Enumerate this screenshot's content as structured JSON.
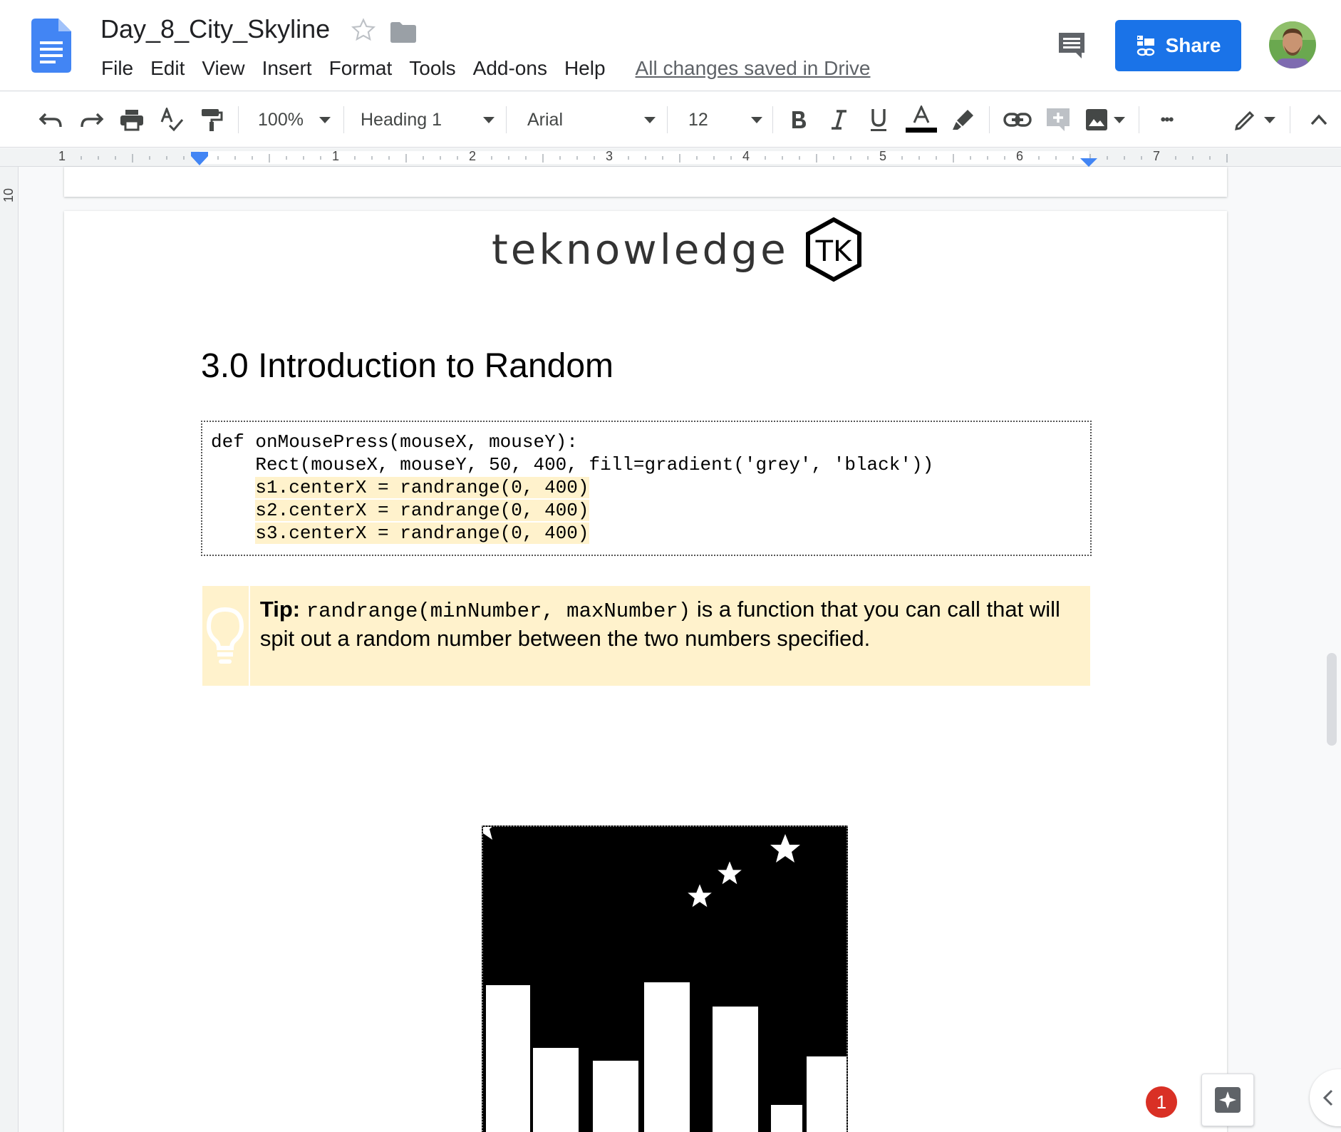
{
  "app": {
    "name": "Google Docs"
  },
  "header": {
    "doc_title": "Day_8_City_Skyline",
    "menu": [
      "File",
      "Edit",
      "View",
      "Insert",
      "Format",
      "Tools",
      "Add-ons",
      "Help"
    ],
    "save_status": "All changes saved in Drive",
    "share_label": "Share"
  },
  "toolbar": {
    "zoom": "100%",
    "style": "Heading 1",
    "font": "Arial",
    "font_size": "12",
    "more_label": "•••",
    "icons": [
      "undo-icon",
      "redo-icon",
      "print-icon",
      "spellcheck-icon",
      "paint-format-icon",
      "bold-icon",
      "italic-icon",
      "underline-icon",
      "text-color-icon",
      "highlight-icon",
      "link-icon",
      "add-comment-icon",
      "image-icon",
      "more-icon",
      "editing-mode-icon",
      "collapse-icon"
    ]
  },
  "ruler": {
    "labels": [
      "1",
      "1",
      "2",
      "3",
      "4",
      "5",
      "6",
      "7"
    ],
    "vertical_label": "10"
  },
  "document": {
    "brand": "teknowledge",
    "brand_mark": "TK",
    "heading": "3.0 Introduction to Random",
    "code": {
      "line1": "def onMousePress(mouseX, mouseY):",
      "line2": "    Rect(mouseX, mouseY, 50, 400, fill=gradient('grey', 'black'))",
      "line3_indent": "    ",
      "line3": "s1.centerX = randrange(0, 400)",
      "line4_indent": "    ",
      "line4": "s2.centerX = randrange(0, 400)",
      "line5_indent": "    ",
      "line5": "s3.centerX = randrange(0, 400)"
    },
    "tip": {
      "label": "Tip:",
      "code": "randrange(minNumber, maxNumber)",
      "text": " is a function that you can call that will spit out a random number between the two numbers specified."
    }
  },
  "notifications": {
    "count": "1"
  },
  "colors": {
    "accent": "#1a73e8",
    "tip_background": "#fff2cc",
    "code_highlight": "#fff2cc",
    "badge": "#d93025"
  }
}
